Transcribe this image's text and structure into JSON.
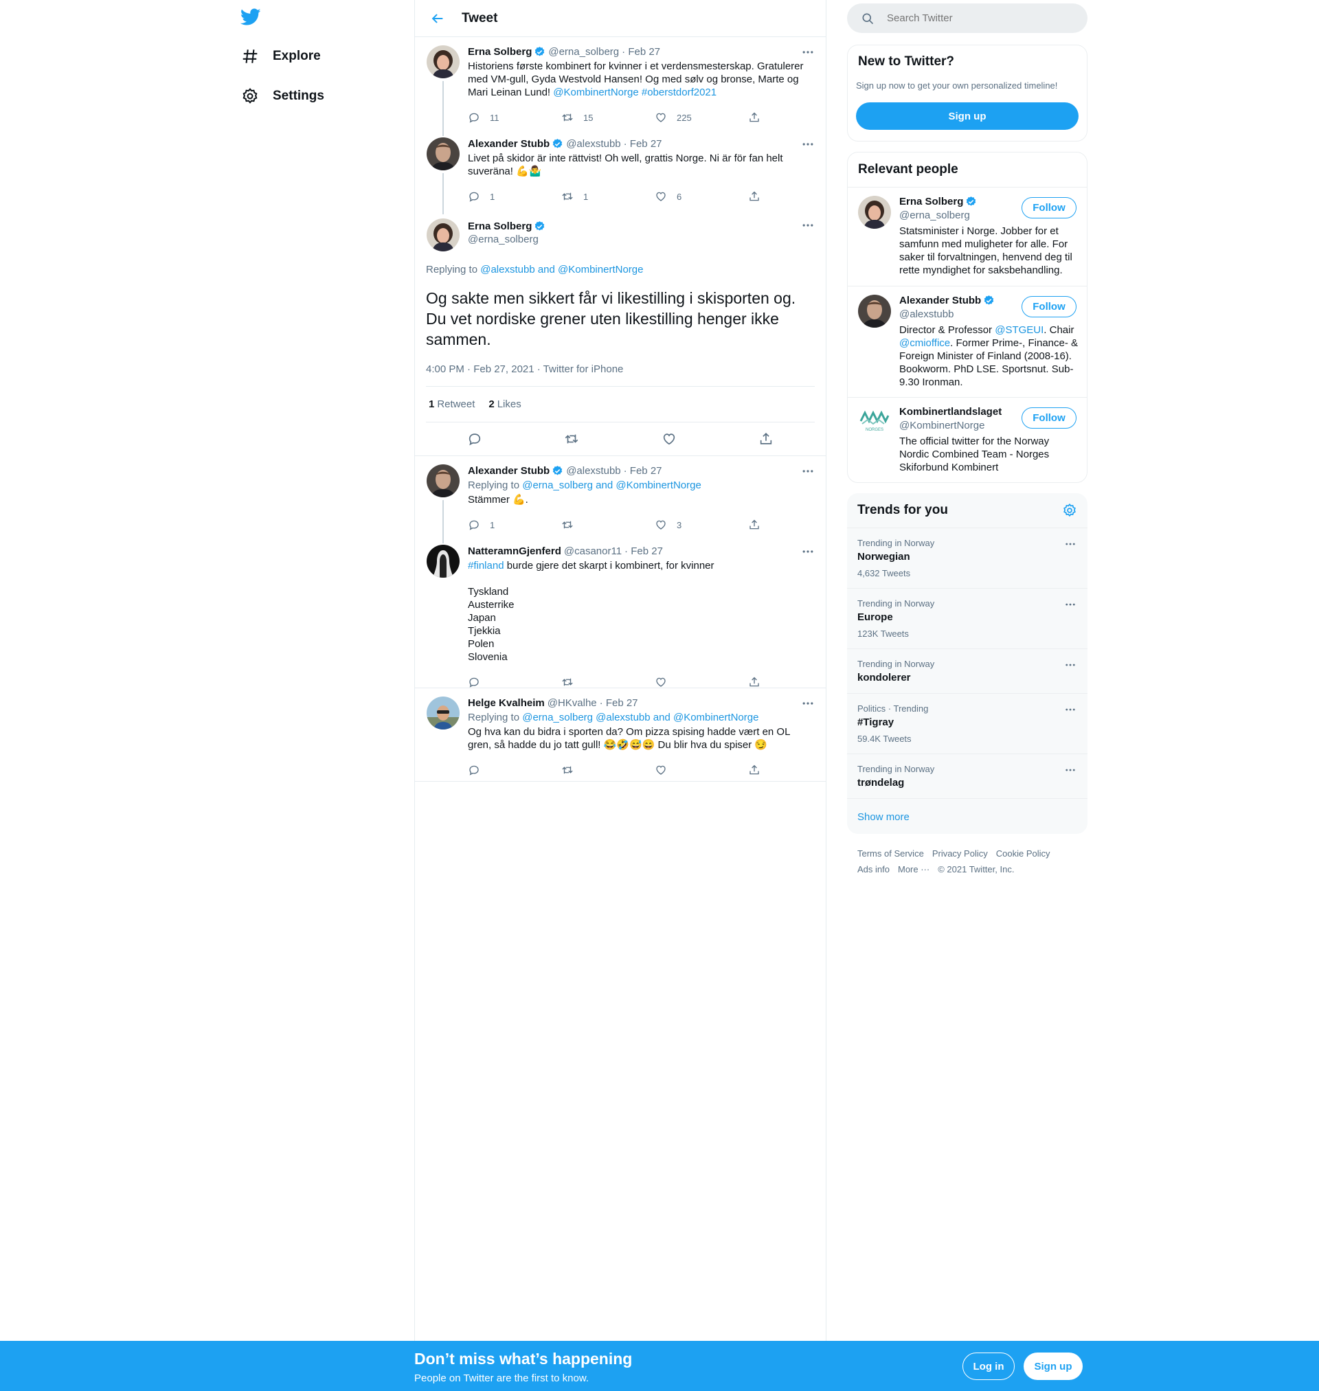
{
  "nav": {
    "items": [
      {
        "label": "Explore",
        "icon": "hashtag-icon"
      },
      {
        "label": "Settings",
        "icon": "gear-icon"
      }
    ]
  },
  "header": {
    "title": "Tweet"
  },
  "thread": [
    {
      "name": "Erna Solberg",
      "handle": "@erna_solberg",
      "date": "· Feb 27",
      "text_plain": "Historiens første kombinert for kvinner i et verdensmesterskap. Gratulerer med VM-gull, Gyda Westvold Hansen! Og med sølv og bronse, Marte og Mari Leinan Lund! ",
      "text_links": "@KombinertNorge #oberstdorf2021",
      "replies": "11",
      "retweets": "15",
      "likes": "225"
    },
    {
      "name": "Alexander Stubb",
      "handle": "@alexstubb",
      "date": "· Feb 27",
      "text_plain": "Livet på skidor är inte rättvist! Oh well, grattis Norge. Ni är för fan helt suveräna! 💪🤷‍♂️",
      "replies": "1",
      "retweets": "1",
      "likes": "6"
    }
  ],
  "focus": {
    "name": "Erna Solberg",
    "handle": "@erna_solberg",
    "replying_prefix": "Replying to ",
    "replying_to": "@alexstubb and @KombinertNorge",
    "text": "Og sakte men sikkert får vi likestilling i skisporten og. Du vet nordiske grener uten likestilling henger ikke sammen.",
    "meta": "4:00 PM · Feb 27, 2021 · Twitter for iPhone",
    "retweets_count": "1",
    "retweets_label": "Retweet",
    "likes_count": "2",
    "likes_label": "Likes"
  },
  "replies": [
    {
      "name": "Alexander Stubb",
      "handle": "@alexstubb",
      "date": "· Feb 27",
      "replying_prefix": "Replying to ",
      "replying_to": "@erna_solberg and @KombinertNorge",
      "text": "Stämmer 💪.",
      "replies": "1",
      "retweets": "",
      "likes": "3"
    },
    {
      "name": "NatteramnGjenferd",
      "handle": "@casanor11",
      "date": "· Feb 27",
      "hashtag": "#finland",
      "text": " burde gjere det skarpt i kombinert, for kvinner\n\nTyskland\nAusterrike\nJapan\nTjekkia\nPolen\nSlovenia",
      "replies": "",
      "retweets": "",
      "likes": ""
    },
    {
      "name": "Helge Kvalheim",
      "handle": "@HKvalhe",
      "date": "· Feb 27",
      "replying_prefix": "Replying to ",
      "replying_to": "@erna_solberg @alexstubb and @KombinertNorge",
      "text": "Og hva kan du bidra i sporten da? Om pizza spising hadde vært en OL gren, så hadde du jo tatt gull! 😂🤣😅😄 Du blir hva du spiser 😏",
      "replies": "",
      "retweets": "",
      "likes": ""
    }
  ],
  "search": {
    "placeholder": "Search Twitter"
  },
  "new_to_twitter": {
    "title": "New to Twitter?",
    "subtitle": "Sign up now to get your own personalized timeline!",
    "button": "Sign up"
  },
  "relevant": {
    "title": "Relevant people",
    "follow_label": "Follow",
    "people": [
      {
        "name": "Erna Solberg",
        "handle": "@erna_solberg",
        "verified": true,
        "bio": "Statsminister i Norge. Jobber for et samfunn med muligheter for alle. For saker til forvaltningen, henvend deg til rette myndighet for saksbehandling."
      },
      {
        "name": "Alexander Stubb",
        "handle": "@alexstubb",
        "verified": true,
        "bio_1": "Director & Professor ",
        "bio_link1": "@STGEUI",
        "bio_2": ". Chair ",
        "bio_link2": "@cmioffice",
        "bio_3": ". Former Prime-, Finance- & Foreign Minister of Finland (2008-16). Bookworm. PhD LSE. Sportsnut. Sub-9.30 Ironman."
      },
      {
        "name": "Kombinertlandslaget",
        "handle": "@KombinertNorge",
        "verified": false,
        "bio": "The official twitter for the Norway Nordic Combined Team - Norges Skiforbund Kombinert",
        "logo_text": "NORGES SKIFORBUND"
      }
    ]
  },
  "trends": {
    "title": "Trends for you",
    "items": [
      {
        "context": "Trending in Norway",
        "name": "Norwegian",
        "count": "4,632 Tweets"
      },
      {
        "context": "Trending in Norway",
        "name": "Europe",
        "count": "123K Tweets"
      },
      {
        "context": "Trending in Norway",
        "name": "kondolerer",
        "count": ""
      },
      {
        "context": "Politics · Trending",
        "name": "#Tigray",
        "count": "59.4K Tweets"
      },
      {
        "context": "Trending in Norway",
        "name": "trøndelag",
        "count": ""
      }
    ],
    "show_more": "Show more"
  },
  "footer": {
    "row1": [
      "Terms of Service",
      "Privacy Policy",
      "Cookie Policy"
    ],
    "row2": [
      "Ads info",
      "More ···",
      "© 2021 Twitter, Inc."
    ]
  },
  "bottom_bar": {
    "title": "Don’t miss what’s happening",
    "subtitle": "People on Twitter are the first to know.",
    "login": "Log in",
    "signup": "Sign up"
  },
  "colors": {
    "accent": "#1da1f2",
    "link": "#1b95e0",
    "muted": "#5b7083",
    "border": "#e6ecf0"
  }
}
